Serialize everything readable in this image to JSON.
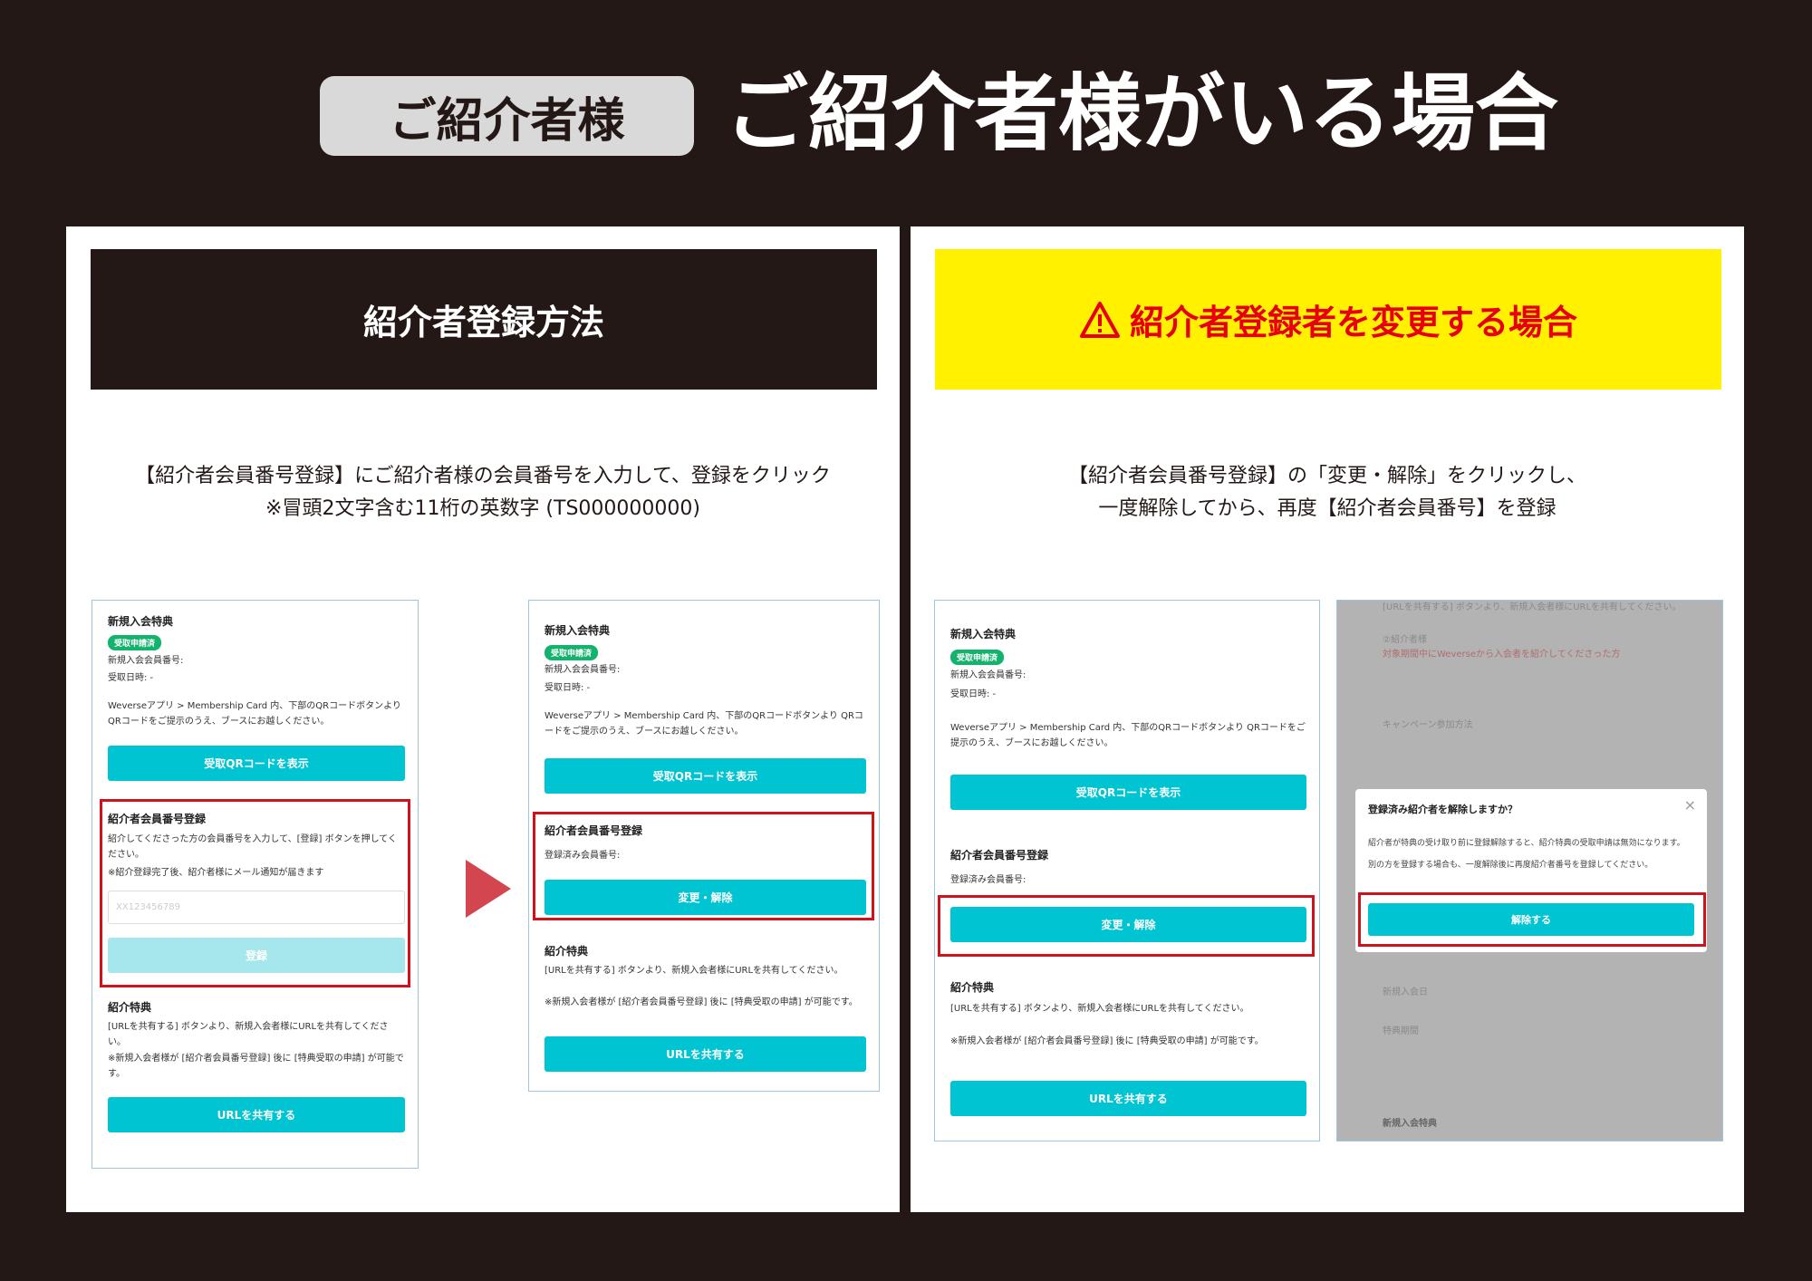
{
  "header": {
    "badge": "ご紹介者様",
    "title": "ご紹介者様がいる場合"
  },
  "left_panel": {
    "banner": "紹介者登録方法",
    "desc_line1": "【紹介者会員番号登録】にご紹介者様の会員番号を入力して、登録をクリック",
    "desc_line2": "※冒頭2文字含む11桁の英数字 (TS000000000)"
  },
  "right_panel": {
    "banner": "紹介者登録者を変更する場合",
    "desc_line1": "【紹介者会員番号登録】の「変更・解除」をクリックし、",
    "desc_line2": "一度解除してから、再度【紹介者会員番号】を登録"
  },
  "colors": {
    "background": "#231816",
    "accent_teal": "#00c4d2",
    "highlight_red": "#d0121b",
    "warning_yellow": "#fff100",
    "warning_text": "#e60012"
  },
  "mock": {
    "benefit_title": "新規入会特典",
    "status_pill": "受取申請済",
    "member_no": "新規入会会員番号:",
    "received_date": "受取日時: -",
    "instructions": "Weverseアプリ > Membership Card 内、下部のQRコードボタンより QRコードをご提示のうえ、ブースにお越しください。",
    "qr_button": "受取QRコードを表示",
    "referrer_title": "紹介者会員番号登録",
    "referrer_desc": "紹介してくださった方の会員番号を入力して、[登録] ボタンを押してください。",
    "referrer_note": "※紹介登録完了後、紹介者様にメール通知が届きます",
    "input_placeholder": "XX123456789",
    "register_button": "登録",
    "registered_label": "登録済み会員番号:",
    "change_button": "変更・解除",
    "referral_benefit_title": "紹介特典",
    "referral_desc": "[URLを共有する] ボタンより、新規入会者様にURLを共有してください。",
    "referral_note": "※新規入会者様が [紹介者会員番号登録] 後に [特典受取の申請] が可能です。",
    "share_button": "URLを共有する"
  },
  "modal": {
    "title": "登録済み紹介者を解除しますか？",
    "close": "×",
    "body1": "紹介者が特典の受け取り前に登録解除すると、紹介特典の受取申請は無効になります。",
    "body2": "別の方を登録する場合も、一度解除後に再度紹介者番号を登録してください。",
    "confirm_button": "解除する"
  },
  "grey_bg": {
    "line1": "[URLを共有する] ボタンより、新規入会者様にURLを共有してください。",
    "line2": "②紹介者様",
    "line3": "対象期間中にWeverseから入会者を紹介してくださった方",
    "line4": "キャンペーン参加方法",
    "line5": "新規入会日",
    "line6": "特典期間",
    "line7": "新規入会特典"
  }
}
